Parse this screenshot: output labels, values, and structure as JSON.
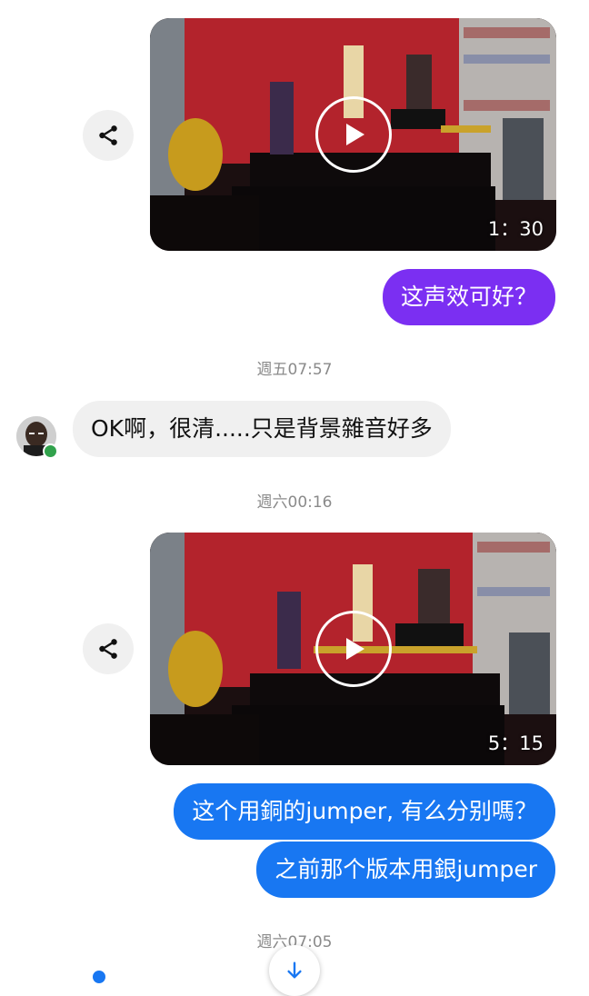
{
  "messages": {
    "video1": {
      "duration": "1：30"
    },
    "bubble1": "这声效可好？",
    "timestamp1": "週五07:57",
    "bubble2": "OK啊，很清.....只是背景雜音好多",
    "timestamp2": "週六00:16",
    "video2": {
      "duration": "5：15"
    },
    "bubble3": "这个用銅的jumper, 有么分别嗎？",
    "bubble4": "之前那个版本用銀jumper",
    "timestamp3": "週六07:05"
  },
  "icons": {
    "share": "share-icon",
    "play": "play-icon",
    "scroll": "arrow-down-icon",
    "avatar": "avatar"
  },
  "colors": {
    "sent_purple": "#7b2ff2",
    "sent_blue": "#1877f2",
    "received_gray": "#f0f0f0",
    "presence_green": "#31a24c"
  }
}
